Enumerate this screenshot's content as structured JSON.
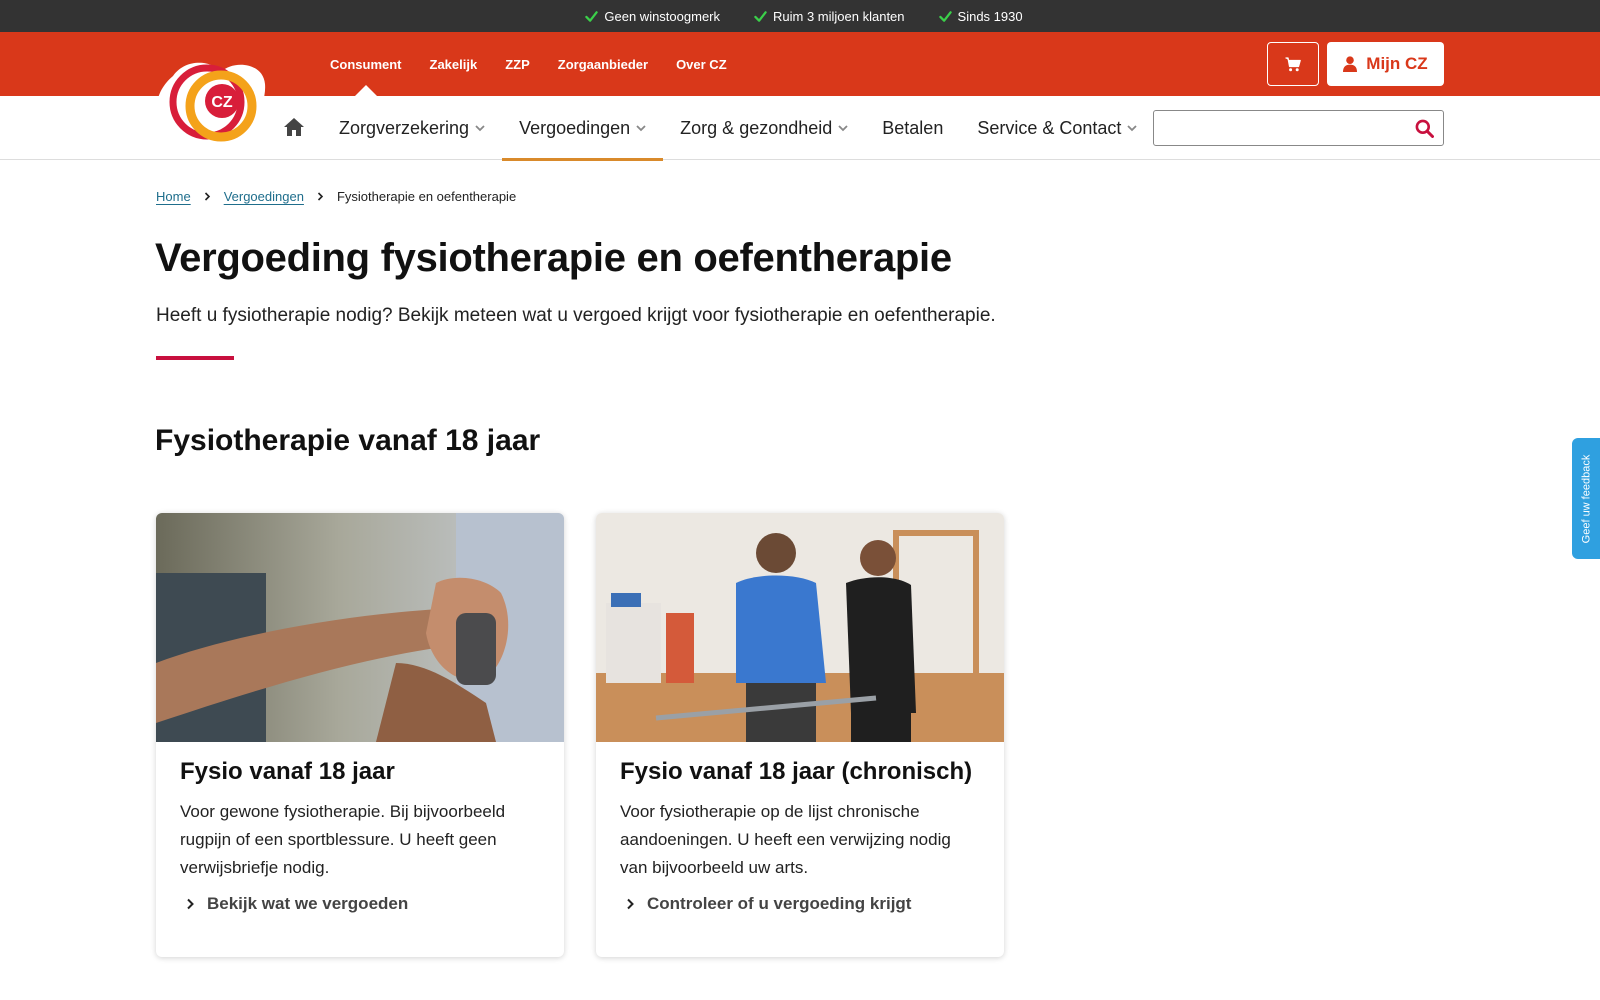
{
  "usp_bar": {
    "items": [
      "Geen winstoogmerk",
      "Ruim 3 miljoen klanten",
      "Sinds 1930"
    ],
    "icon": "check-icon",
    "check_color": "#3bd04a"
  },
  "segment_nav": {
    "items": [
      "Consument",
      "Zakelijk",
      "ZZP",
      "Zorgaanbieder",
      "Over CZ"
    ],
    "active": "Consument"
  },
  "header": {
    "brand_color": "#d9381a",
    "logo_text": "CZ",
    "cart_icon": "cart-icon",
    "account_icon": "user-icon",
    "account_label": "Mijn CZ"
  },
  "main_nav": {
    "home_icon": "home-icon",
    "items": [
      "Zorgverzekering",
      "Vergoedingen",
      "Zorg & gezondheid",
      "Betalen",
      "Service & Contact"
    ],
    "active": "Vergoedingen",
    "search": {
      "value": "",
      "placeholder": "",
      "icon": "search-icon"
    }
  },
  "breadcrumb": {
    "items": [
      "Home",
      "Vergoedingen",
      "Fysiotherapie en oefentherapie"
    ]
  },
  "page": {
    "title": "Vergoeding fysiotherapie en oefentherapie",
    "intro": "Heeft u fysiotherapie nodig? Bekijk meteen wat u vergoed krijgt voor fysiotherapie en oefentherapie.",
    "accent_color": "#c8103e",
    "section_title": "Fysiotherapie vanaf 18 jaar"
  },
  "cards": [
    {
      "title": "Fysio vanaf 18 jaar",
      "text": "Voor gewone fysiotherapie. Bij bijvoorbeeld rugpijn of een sportblessure. U heeft geen verwijsbriefje nodig.",
      "link": "Bekijk wat we vergoeden",
      "image": "hand-exercise-band-photo"
    },
    {
      "title": "Fysio vanaf 18 jaar (chronisch)",
      "text": "Voor fysiotherapie op de lijst chronische aandoeningen. U heeft een verwijzing nodig van bijvoorbeeld uw arts.",
      "link": "Controleer of u vergoeding krijgt",
      "image": "therapist-assisting-patient-photo"
    }
  ],
  "feedback_tab": {
    "label": "Geef uw feedback",
    "color": "#2fa0e0"
  }
}
